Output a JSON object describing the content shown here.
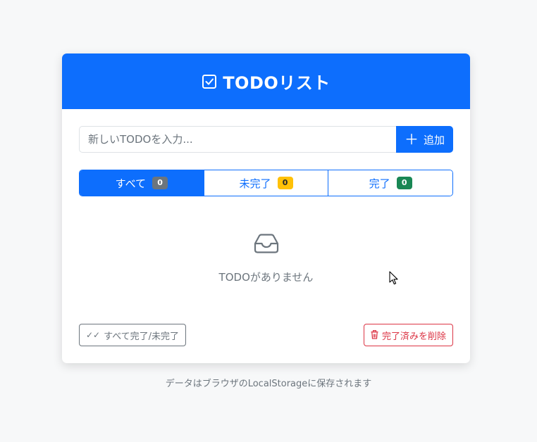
{
  "header": {
    "title": "TODOリスト",
    "icon": "check-square-icon"
  },
  "input": {
    "placeholder": "新しいTODOを入力...",
    "value": ""
  },
  "add_button": {
    "label": "追加",
    "icon": "plus-icon"
  },
  "filters": [
    {
      "label": "すべて",
      "count": "0",
      "active": true,
      "badge_color": "#6c757d"
    },
    {
      "label": "未完了",
      "count": "0",
      "active": false,
      "badge_color": "#ffc107"
    },
    {
      "label": "完了",
      "count": "0",
      "active": false,
      "badge_color": "#198754"
    }
  ],
  "empty": {
    "icon": "inbox-icon",
    "message": "TODOがありません"
  },
  "actions": {
    "toggle_all_label": "すべて完了/未完了",
    "toggle_all_icon": "double-check-icon",
    "delete_completed_label": "完了済みを削除",
    "delete_completed_icon": "trash-icon"
  },
  "footnote": "データはブラウザのLocalStorageに保存されます",
  "colors": {
    "primary": "#0d6efd",
    "secondary": "#6c757d",
    "warning": "#ffc107",
    "success": "#198754",
    "danger": "#dc3545"
  }
}
